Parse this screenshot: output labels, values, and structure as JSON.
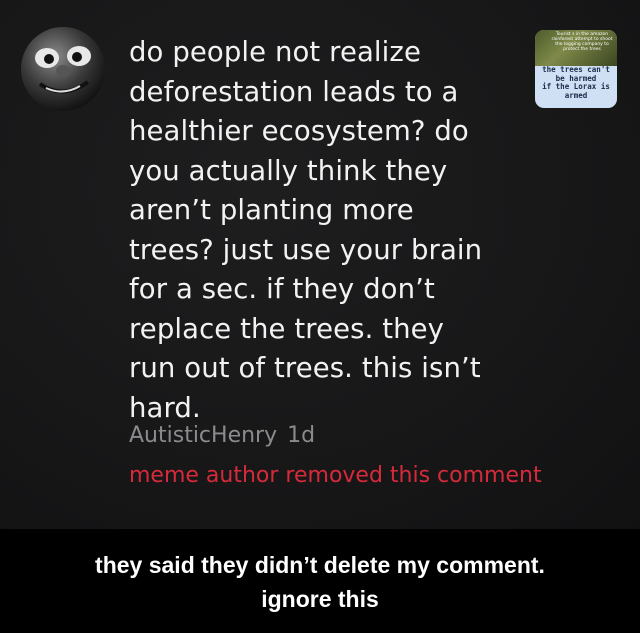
{
  "comment": {
    "lines": [
      "do people not realize",
      "deforestation leads to a",
      "healthier ecosystem? do",
      "you actually think they",
      "aren’t planting more",
      "trees? just use your brain",
      "for a sec. if they don’t",
      "replace the trees. they",
      "run out of trees. this isn’t",
      "hard."
    ],
    "author": "AutisticHenry",
    "time": "1d",
    "removed_notice": "meme author removed this comment",
    "removed_color": "#d62a3b"
  },
  "thumbnail": {
    "top_text": "Tourist s in the amazon rainforest attempt to shoot the logging company to protect the trees",
    "lines": [
      "the trees can't",
      "be harmed",
      "if the Lorax is",
      "armed"
    ]
  },
  "caption": {
    "line1": "they said they didn’t delete my comment.",
    "line2": "ignore this"
  }
}
